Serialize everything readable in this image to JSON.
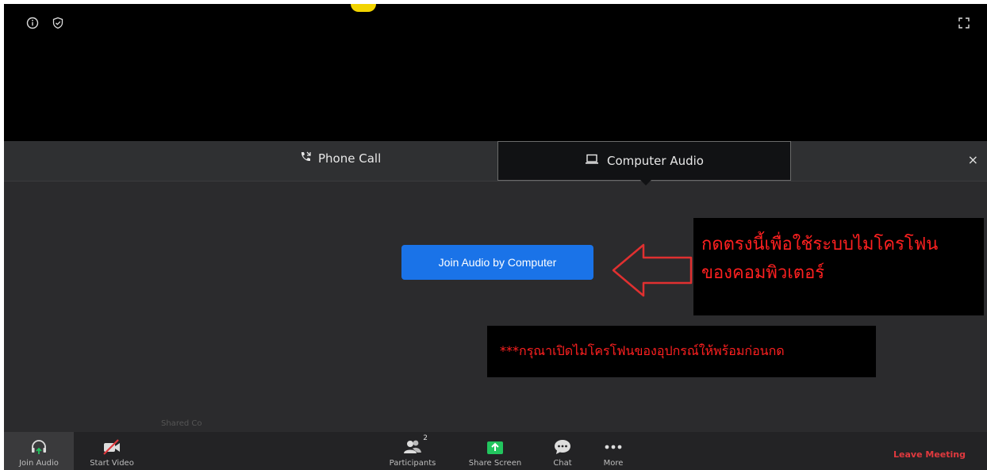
{
  "top": {
    "icons": [
      "info-icon",
      "shield-icon"
    ],
    "fullscreen_icon": "fullscreen-icon"
  },
  "audio_panel": {
    "tabs": {
      "phone_call": "Phone Call",
      "computer_audio": "Computer Audio"
    },
    "close_label": "×",
    "join_button": "Join Audio by Computer",
    "ghost_text": "Shared Co"
  },
  "annotations": {
    "note_main_line1": "กดตรงนี้เพื่อใช้ระบบไมโครโฟน",
    "note_main_line2": "ของคอมพิวเตอร์",
    "note_secondary": "***กรุณาเปิดไมโครโฟนของอุปกรณ์ให้พร้อมก่อนกด",
    "color": "#ff2020"
  },
  "toolbar": {
    "join_audio": "Join Audio",
    "start_video": "Start Video",
    "participants": "Participants",
    "participants_count": "2",
    "share_screen": "Share Screen",
    "chat": "Chat",
    "more": "More",
    "leave": "Leave Meeting"
  },
  "colors": {
    "accent_blue": "#1a73e8",
    "share_green": "#22c55e",
    "leave_red": "#e0393e"
  }
}
